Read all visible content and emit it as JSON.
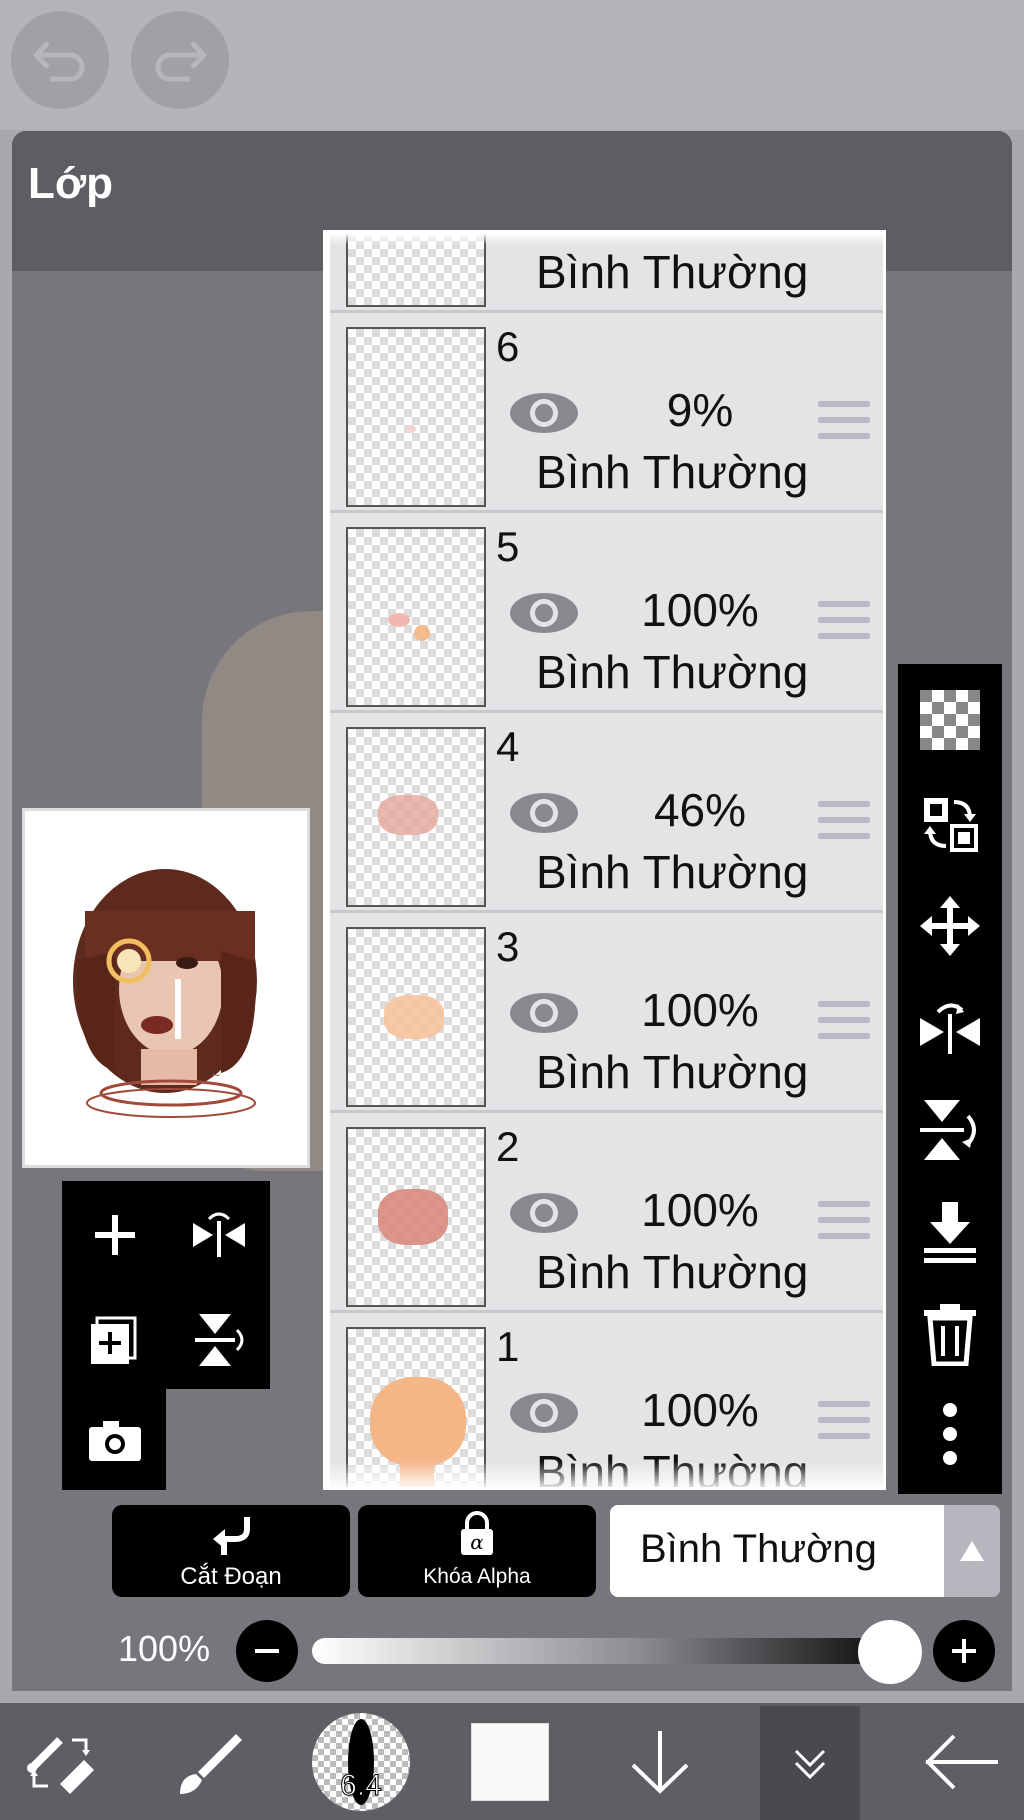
{
  "panel": {
    "title": "Lớp"
  },
  "layers": [
    {
      "number": "",
      "opacity": "",
      "blend": "Bình Thường"
    },
    {
      "number": "6",
      "opacity": "9%",
      "blend": "Bình Thường"
    },
    {
      "number": "5",
      "opacity": "100%",
      "blend": "Bình Thường"
    },
    {
      "number": "4",
      "opacity": "46%",
      "blend": "Bình Thường"
    },
    {
      "number": "3",
      "opacity": "100%",
      "blend": "Bình Thường"
    },
    {
      "number": "2",
      "opacity": "100%",
      "blend": "Bình Thường"
    },
    {
      "number": "1",
      "opacity": "100%",
      "blend": "Bình Thường"
    }
  ],
  "actions": {
    "clip_label": "Cắt Đoạn",
    "alpha_lock_label": "Khóa Alpha"
  },
  "blend_mode": {
    "selected": "Bình Thường"
  },
  "opacity": {
    "label": "100%",
    "value": 1.0
  },
  "brush": {
    "size": "6.4"
  },
  "colors": {
    "panel": "#6e6d73",
    "layer_bg": "#e4e4e6",
    "toolbar": "#000000"
  }
}
